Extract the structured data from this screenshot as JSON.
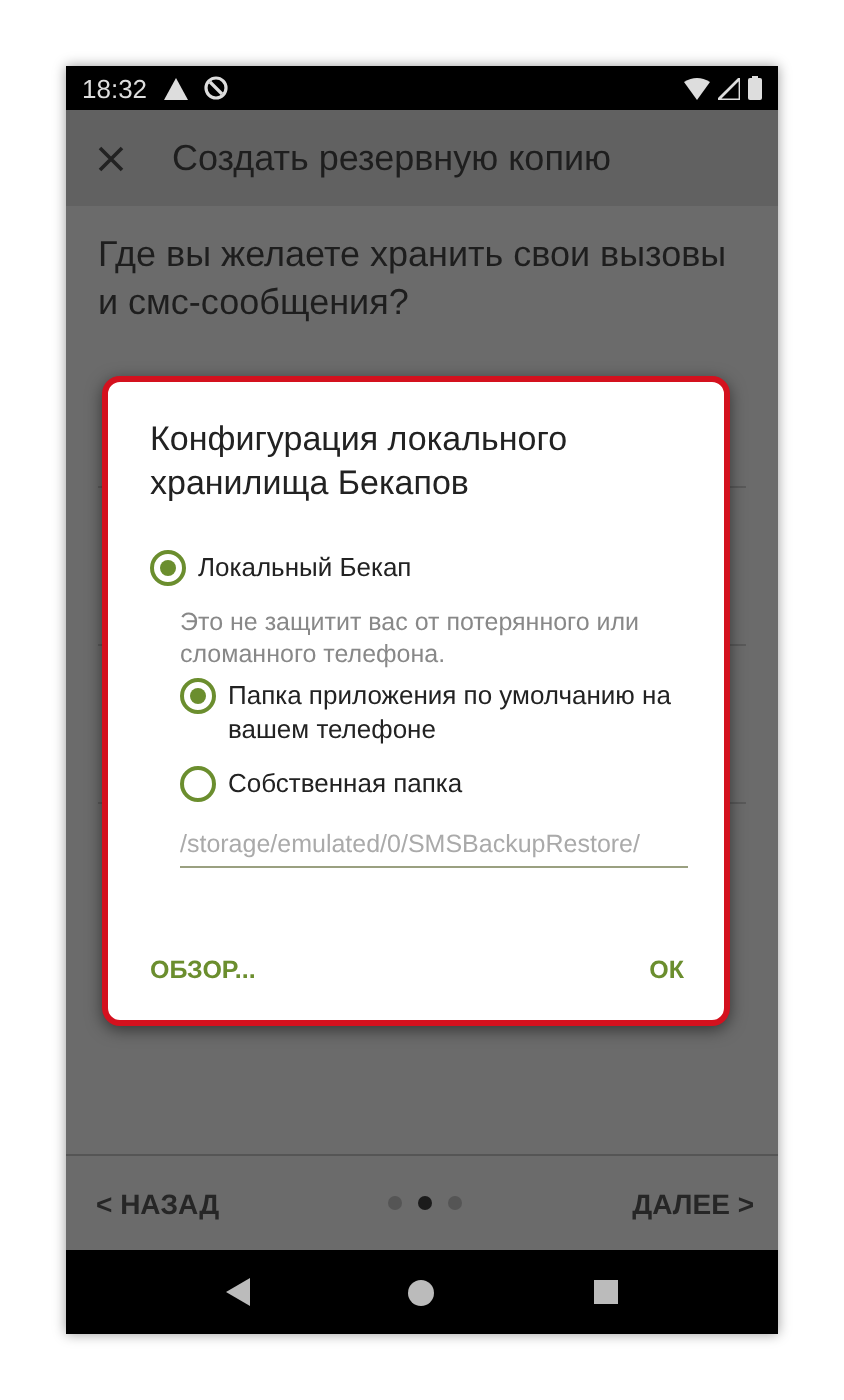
{
  "status_bar": {
    "time": "18:32"
  },
  "app_bar": {
    "title": "Создать резервную копию"
  },
  "question": "Где вы желаете хранить свои вызовы и смс-сообщения?",
  "dialog": {
    "title": "Конфигурация локального хранилища Бекапов",
    "options": [
      {
        "label": "Локальный Бекап",
        "selected": true,
        "note": "Это не защитит вас от потерянного или сломанного телефона.",
        "children": [
          {
            "label": "Папка приложения по умолчанию на вашем телефоне",
            "selected": true
          },
          {
            "label": "Собственная папка",
            "selected": false
          }
        ]
      }
    ],
    "path_field": {
      "placeholder": "/storage/emulated/0/SMSBackupRestore/"
    },
    "buttons": [
      "ОБЗОР...",
      "ОК"
    ]
  },
  "bottom_bar": {
    "back": "< НАЗАД",
    "next": "ДАЛЕЕ >",
    "pages": [
      {
        "selected": false
      },
      {
        "selected": true
      },
      {
        "selected": false
      }
    ]
  }
}
